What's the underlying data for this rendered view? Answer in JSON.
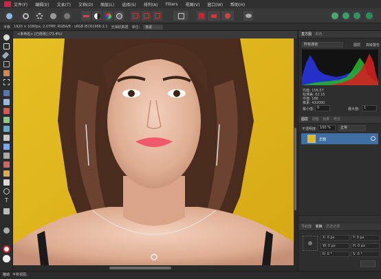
{
  "menu": [
    "文件(F)",
    "编辑(E)",
    "文本(T)",
    "文档(D)",
    "图层(L)",
    "选择(S)",
    "排列(A)",
    "Filters",
    "视图(V)",
    "窗口(W)",
    "帮助(H)"
  ],
  "context_bar": {
    "tool_name": "平移",
    "doc_info": "1920 × 1080px, 2.07MP, RGBA/8 - sRGB IEC61966-2.1",
    "exif": "无相机数据",
    "unit_label": "单位:",
    "unit_value": "像素"
  },
  "document_tab": "<未命名> [已修改] (73.4%)",
  "histogram": {
    "tabs": [
      "直方图",
      "颜色"
    ],
    "mode_select": "所有通道",
    "cb_label": "图层",
    "warn_label": "高级警告",
    "stats": [
      "均值: 156.57",
      "标准差: 62.15",
      "中值: 186",
      "像素: 432000"
    ],
    "min_label": "最小值:",
    "min_value": "0",
    "max_label": "最大值:",
    "max_value": "1"
  },
  "layers": {
    "tabs": [
      "图层",
      "调整",
      "效果",
      "样式"
    ],
    "opacity_label": "不透明度:",
    "opacity_value": "100 %",
    "blend_mode": "正常",
    "layer_name": "正面"
  },
  "transform": {
    "tabs": [
      "导航器",
      "变换",
      "历史记录"
    ],
    "fields": [
      "X: 0 px",
      "Y: 0 px",
      "W: 0 px",
      "H: 0 px",
      "R: 0 °",
      "S: 0 °"
    ]
  },
  "status": {
    "tool": "拖动",
    "hint": "平移视图。"
  },
  "colors": {
    "accent": "#3f6fa3",
    "canvas_bg": "#e2b91d",
    "brand": "#c42a4a"
  }
}
